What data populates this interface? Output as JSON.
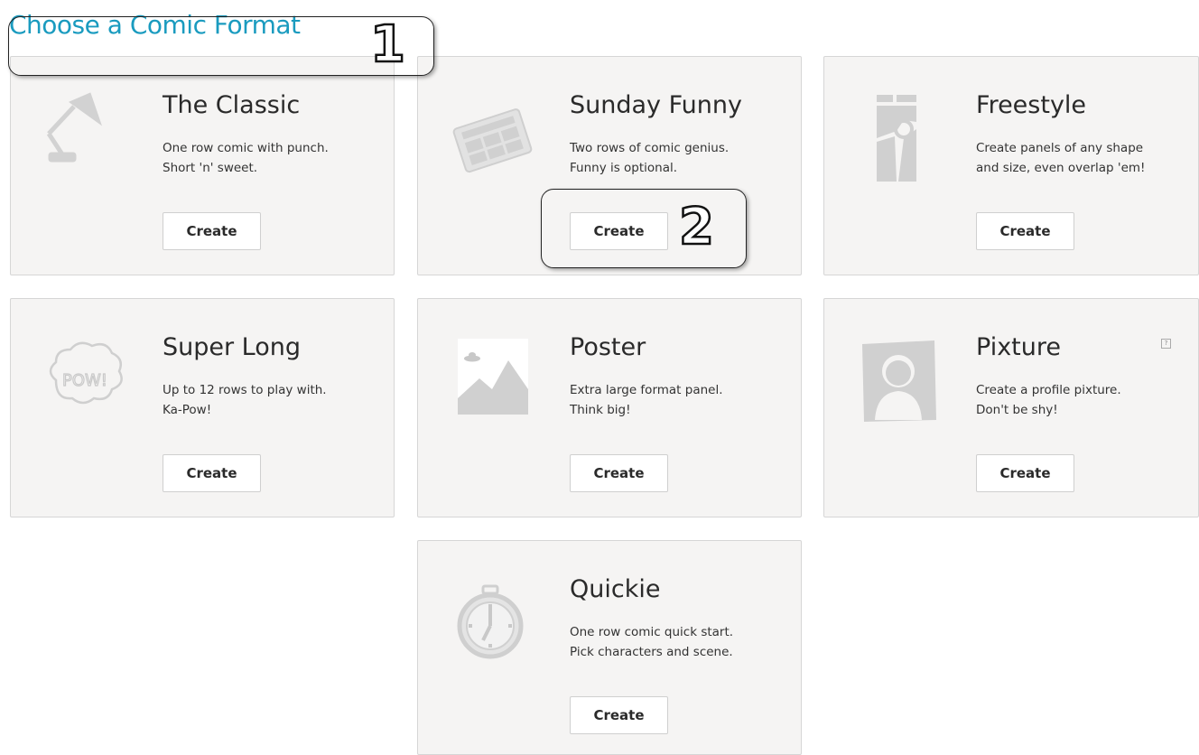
{
  "page": {
    "title": "Choose a Comic Format"
  },
  "callouts": [
    {
      "number": "1"
    },
    {
      "number": "2"
    }
  ],
  "formats": [
    {
      "title": "The Classic",
      "line1": "One row comic with punch.",
      "line2": "Short 'n' sweet.",
      "button": "Create",
      "icon": "desk-lamp-icon"
    },
    {
      "title": "Sunday Funny",
      "line1": "Two rows of comic genius.",
      "line2": "Funny is optional.",
      "button": "Create",
      "icon": "newspaper-icon"
    },
    {
      "title": "Freestyle",
      "line1": "Create panels of any shape",
      "line2": "and size, even overlap 'em!",
      "button": "Create",
      "icon": "freestyle-panels-icon"
    },
    {
      "title": "Super Long",
      "line1": "Up to 12 rows to play with.",
      "line2": "Ka-Pow!",
      "button": "Create",
      "icon": "pow-bubble-icon",
      "icon_text": "POW!"
    },
    {
      "title": "Poster",
      "line1": "Extra large format panel.",
      "line2": "Think big!",
      "button": "Create",
      "icon": "landscape-image-icon"
    },
    {
      "title": "Pixture",
      "line1": "Create a profile pixture.",
      "line2": "Don't be shy!",
      "button": "Create",
      "icon": "profile-silhouette-icon",
      "help": "?"
    },
    {
      "title": "Quickie",
      "line1": "One row comic quick start.",
      "line2": "Pick characters and scene.",
      "button": "Create",
      "icon": "stopwatch-icon"
    }
  ],
  "colors": {
    "accent": "#1a9bbf",
    "card_bg": "#f5f4f3",
    "icon_gray": "#d0d0d0"
  }
}
